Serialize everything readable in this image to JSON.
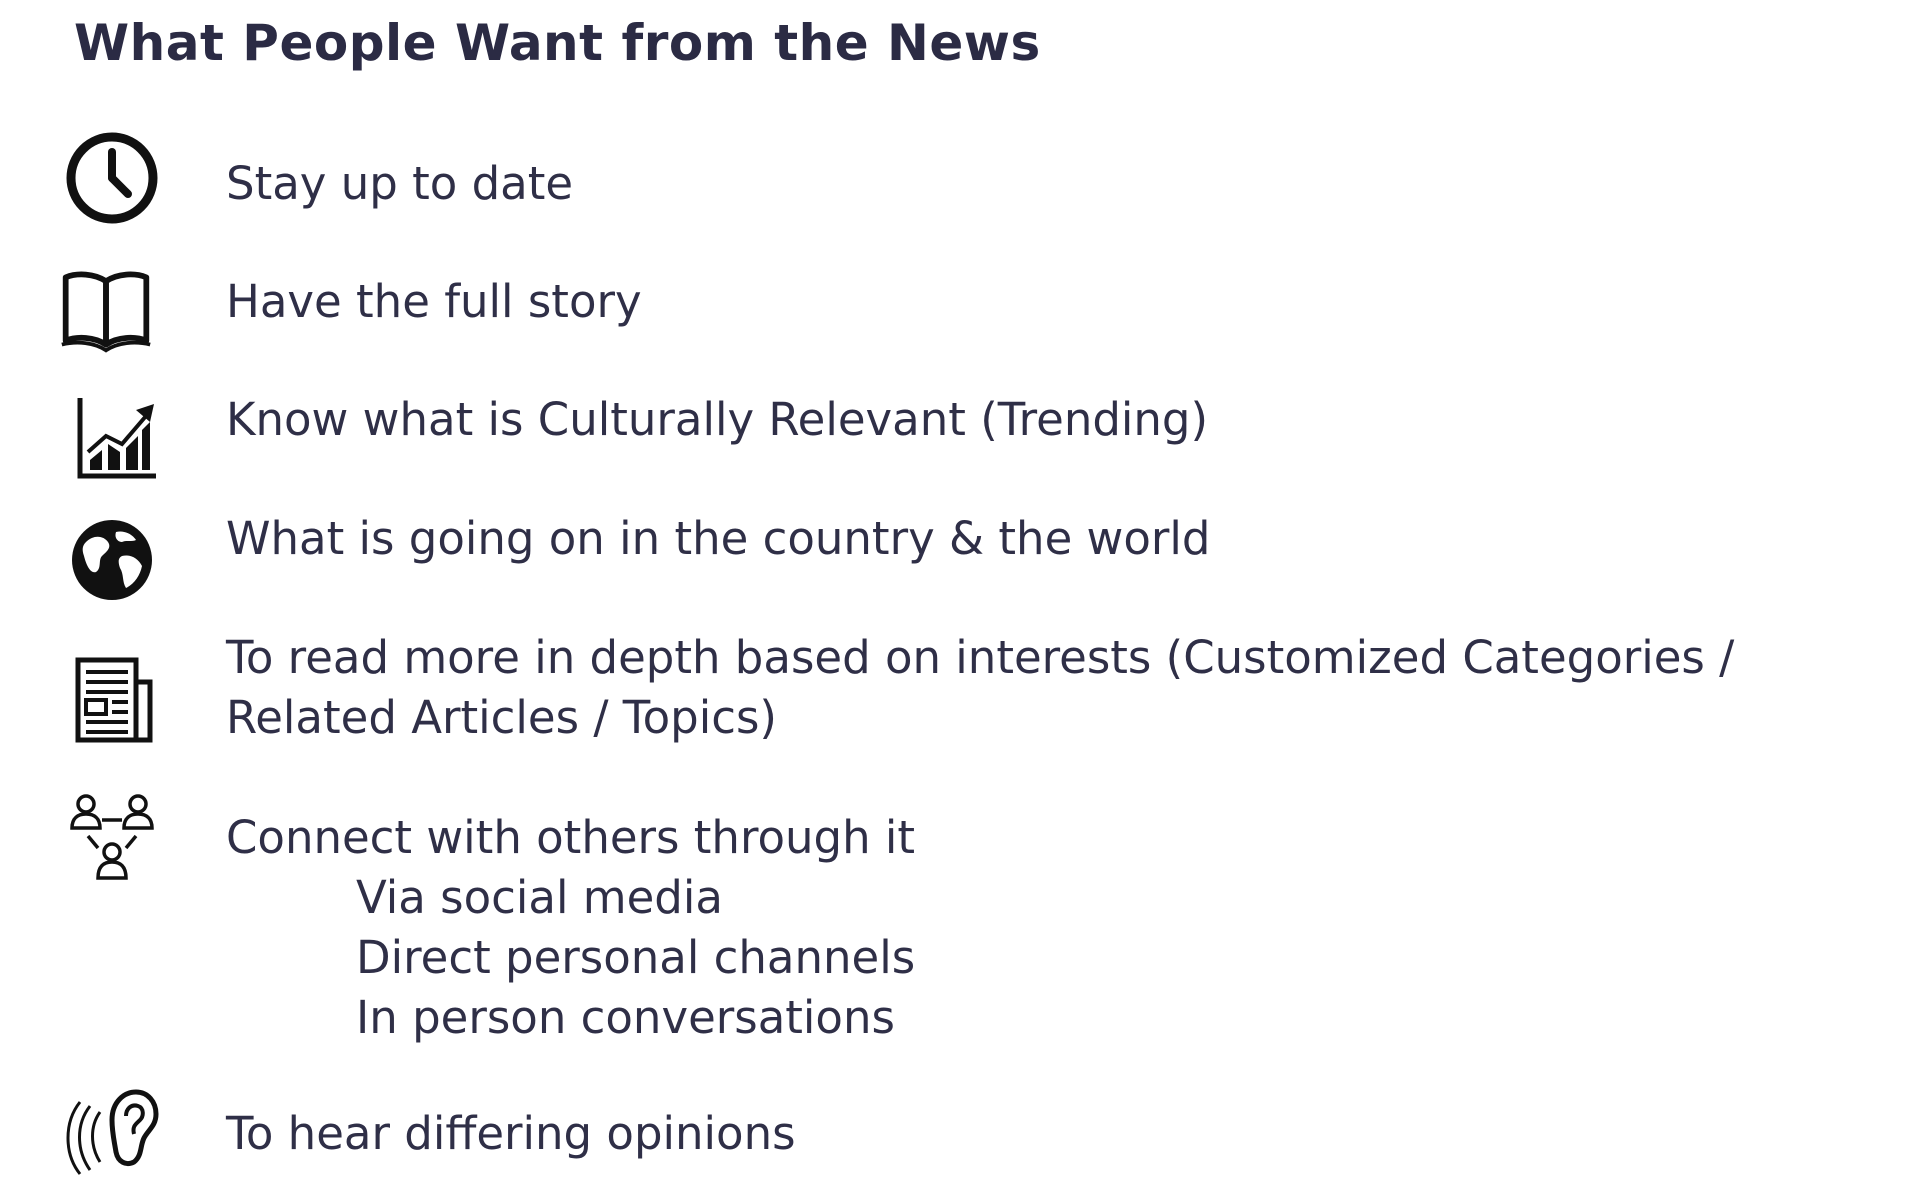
{
  "title": "What People Want from the News",
  "items": [
    {
      "icon": "clock-icon",
      "lines": [
        "Stay up to date"
      ]
    },
    {
      "icon": "open-book-icon",
      "lines": [
        "Have the full story"
      ]
    },
    {
      "icon": "trending-chart-icon",
      "lines": [
        "Know what is Culturally Relevant (Trending)"
      ]
    },
    {
      "icon": "globe-icon",
      "lines": [
        "What is going on in the country & the world"
      ]
    },
    {
      "icon": "newspaper-icon",
      "lines": [
        "To read more in depth based on interests (Customized Categories /",
        "Related Articles / Topics)"
      ]
    },
    {
      "icon": "connected-people-icon",
      "lines": [
        "Connect with others through it"
      ],
      "subitems": [
        "Via social media",
        "Direct personal channels",
        "In person conversations"
      ]
    },
    {
      "icon": "ear-listening-icon",
      "lines": [
        "To hear differing opinions"
      ]
    }
  ],
  "colors": {
    "text": "#2f2f47",
    "title": "#2b2b44",
    "icon": "#111111"
  }
}
